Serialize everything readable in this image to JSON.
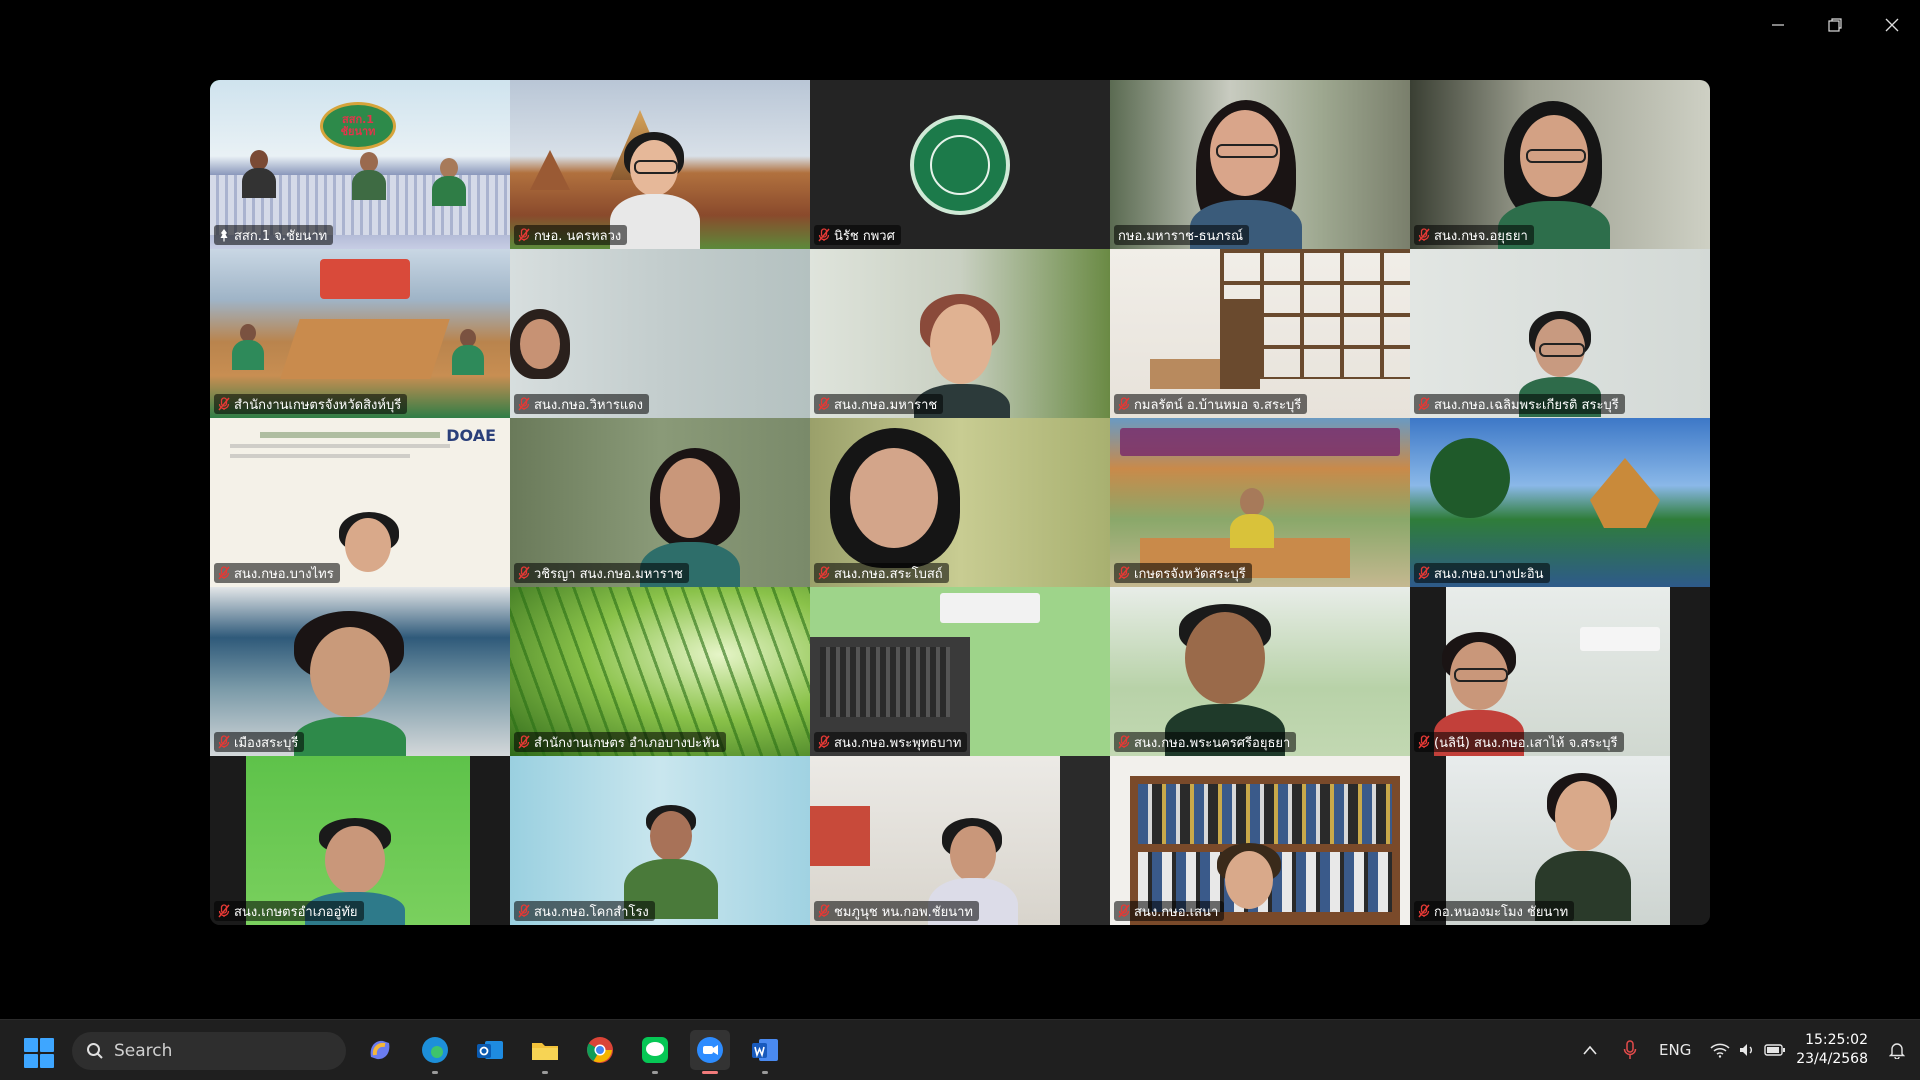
{
  "window": {
    "controls": [
      "minimize-icon",
      "restore-icon",
      "close-icon"
    ]
  },
  "gallery": {
    "tiles": [
      {
        "name": "สสก.1 จ.ชัยนาท",
        "icon": "pin-icon",
        "active": true
      },
      {
        "name": "กษอ. นครหลวง",
        "icon": "mic-muted-icon"
      },
      {
        "name": "นิรัช กพวศ",
        "icon": "mic-muted-icon"
      },
      {
        "name": "กษอ.มหาราช-ธนภรณ์",
        "icon": "none"
      },
      {
        "name": "สนง.กษจ.อยุธยา",
        "icon": "mic-muted-icon"
      },
      {
        "name": "สำนักงานเกษตรจังหวัดสิงห์บุรี",
        "icon": "mic-muted-icon"
      },
      {
        "name": "สนง.กษอ.วิหารแดง",
        "icon": "mic-muted-icon"
      },
      {
        "name": "สนง.กษอ.มหาราช",
        "icon": "mic-muted-icon"
      },
      {
        "name": "กมลรัตน์ อ.บ้านหมอ จ.สระบุรี",
        "icon": "mic-muted-icon"
      },
      {
        "name": "สนง.กษอ.เฉลิมพระเกียรติ สระบุรี",
        "icon": "mic-muted-icon"
      },
      {
        "name": "สนง.กษอ.บางไทร",
        "icon": "mic-muted-icon"
      },
      {
        "name": "วชิรญา สนง.กษอ.มหาราช",
        "icon": "mic-muted-icon"
      },
      {
        "name": "สนง.กษอ.สระโบสถ์",
        "icon": "mic-muted-icon"
      },
      {
        "name": "เกษตรจังหวัดสระบุรี",
        "icon": "mic-muted-icon"
      },
      {
        "name": "สนง.กษอ.บางปะอิน",
        "icon": "mic-muted-icon"
      },
      {
        "name": "เมืองสระบุรี",
        "icon": "mic-muted-icon"
      },
      {
        "name": "สำนักงานเกษตร อำเภอบางปะหัน",
        "icon": "mic-muted-icon"
      },
      {
        "name": "สนง.กษอ.พระพุทธบาท",
        "icon": "mic-muted-icon"
      },
      {
        "name": "สนง.กษอ.พระนครศรีอยุธยา",
        "icon": "mic-muted-icon"
      },
      {
        "name": "(นลินี) สนง.กษอ.เสาไห้ จ.สระบุรี",
        "icon": "mic-muted-icon"
      },
      {
        "name": "สนง.เกษตรอำเภออู่ทัย",
        "icon": "mic-muted-icon"
      },
      {
        "name": "สนง.กษอ.โคกสำโรง",
        "icon": "mic-muted-icon"
      },
      {
        "name": "ชมภูนุช หน.กอพ.ชัยนาท",
        "icon": "mic-muted-icon"
      },
      {
        "name": "สนง.กษอ.เสนา",
        "icon": "mic-muted-icon"
      },
      {
        "name": "กอ.หนองมะโมง ชัยนาท",
        "icon": "mic-muted-icon"
      }
    ],
    "scenes": {
      "logo_sign_text": "สสก.1 ชัยนาท",
      "doc_logo": "DOAE"
    }
  },
  "taskbar": {
    "search_label": "Search",
    "apps": [
      {
        "icon": "copilot-icon"
      },
      {
        "icon": "edge-icon"
      },
      {
        "icon": "outlook-icon"
      },
      {
        "icon": "file-explorer-icon"
      },
      {
        "icon": "chrome-icon"
      },
      {
        "icon": "line-icon"
      },
      {
        "icon": "zoom-icon",
        "active": true
      },
      {
        "icon": "word-icon"
      }
    ],
    "tray": {
      "language": "ENG",
      "time": "15:25:02",
      "date": "23/4/2568"
    }
  },
  "colors": {
    "active_border": "#23d18b",
    "mute_red": "#e53935",
    "taskbar_bg": "#1f1f1f"
  }
}
